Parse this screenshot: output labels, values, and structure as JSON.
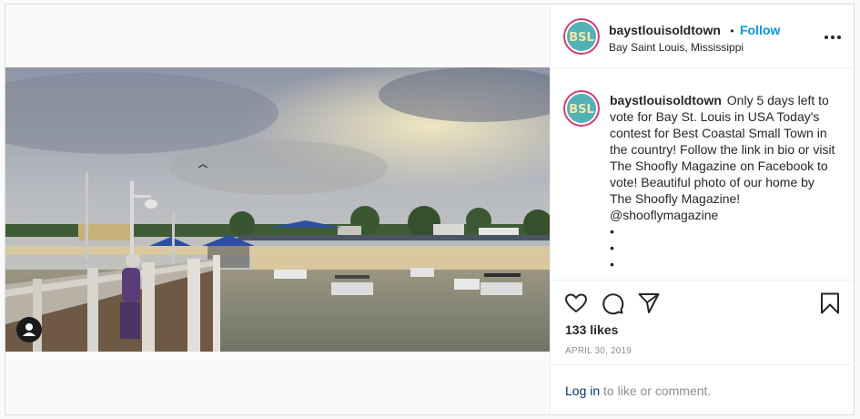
{
  "post": {
    "username": "baystlouisoldtown",
    "follow_separator": "•",
    "follow_label": "Follow",
    "location": "Bay Saint Louis, Mississippi",
    "avatar_lettering": "BSL",
    "more_icon": "more-horizontal-icon",
    "caption": "Only 5 days left to vote for Bay St. Louis in USA Today's contest for Best Coastal Small Town in the country! Follow the link in bio or visit The Shoofly Magazine on Facebook to vote! Beautiful photo of our home by The Shoofly Magazine! @shooflymagazine",
    "caption_dots": [
      "•",
      "•",
      "•"
    ],
    "likes": "133 likes",
    "date": "APRIL 30, 2019",
    "login_link": "Log in",
    "login_suffix": " to like or comment.",
    "icons": {
      "like": "heart-icon",
      "comment": "comment-icon",
      "share": "share-icon",
      "save": "bookmark-icon",
      "user_tag": "user-tag-icon"
    },
    "colors": {
      "follow": "#0095f6",
      "muted": "#8e8e8e",
      "text": "#262626",
      "link": "#00376b"
    }
  }
}
